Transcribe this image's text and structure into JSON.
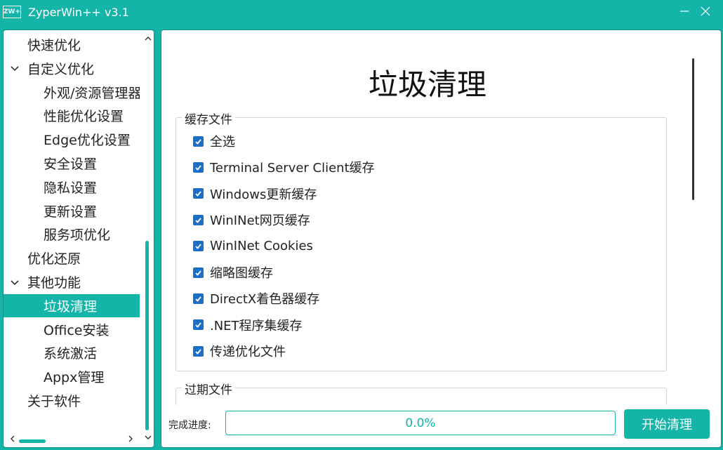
{
  "window": {
    "logo_text": "ZW+",
    "title": "ZyperWin++ v3.1",
    "minimize_icon": "minimize-icon",
    "close_icon": "close-icon"
  },
  "sidebar": {
    "items": [
      {
        "label": "快速优化",
        "level": 0,
        "expandable": false
      },
      {
        "label": "自定义优化",
        "level": 0,
        "expandable": true
      },
      {
        "label": "外观/资源管理器",
        "level": 1
      },
      {
        "label": "性能优化设置",
        "level": 1
      },
      {
        "label": "Edge优化设置",
        "level": 1
      },
      {
        "label": "安全设置",
        "level": 1
      },
      {
        "label": "隐私设置",
        "level": 1
      },
      {
        "label": "更新设置",
        "level": 1
      },
      {
        "label": "服务项优化",
        "level": 1
      },
      {
        "label": "优化还原",
        "level": 0,
        "expandable": false
      },
      {
        "label": "其他功能",
        "level": 0,
        "expandable": true
      },
      {
        "label": "垃圾清理",
        "level": 1,
        "selected": true
      },
      {
        "label": "Office安装",
        "level": 1
      },
      {
        "label": "系统激活",
        "level": 1
      },
      {
        "label": "Appx管理",
        "level": 1
      },
      {
        "label": "关于软件",
        "level": 0,
        "expandable": false
      }
    ]
  },
  "main": {
    "title": "垃圾清理",
    "groups": [
      {
        "label": "缓存文件",
        "options": [
          {
            "label": "全选",
            "checked": true
          },
          {
            "label": "Terminal Server Client缓存",
            "checked": true
          },
          {
            "label": "Windows更新缓存",
            "checked": true
          },
          {
            "label": "WinINet网页缓存",
            "checked": true
          },
          {
            "label": "WinINet Cookies",
            "checked": true
          },
          {
            "label": "缩略图缓存",
            "checked": true
          },
          {
            "label": "DirectX着色器缓存",
            "checked": true
          },
          {
            "label": ".NET程序集缓存",
            "checked": true
          },
          {
            "label": "传递优化文件",
            "checked": true
          }
        ]
      },
      {
        "label": "过期文件",
        "options": []
      }
    ],
    "progress_label": "完成进度:",
    "progress_value": 0.0,
    "progress_text": "0.0%",
    "start_button": "开始清理"
  },
  "colors": {
    "accent": "#14b4a8",
    "checkbox": "#1a6fc7"
  }
}
